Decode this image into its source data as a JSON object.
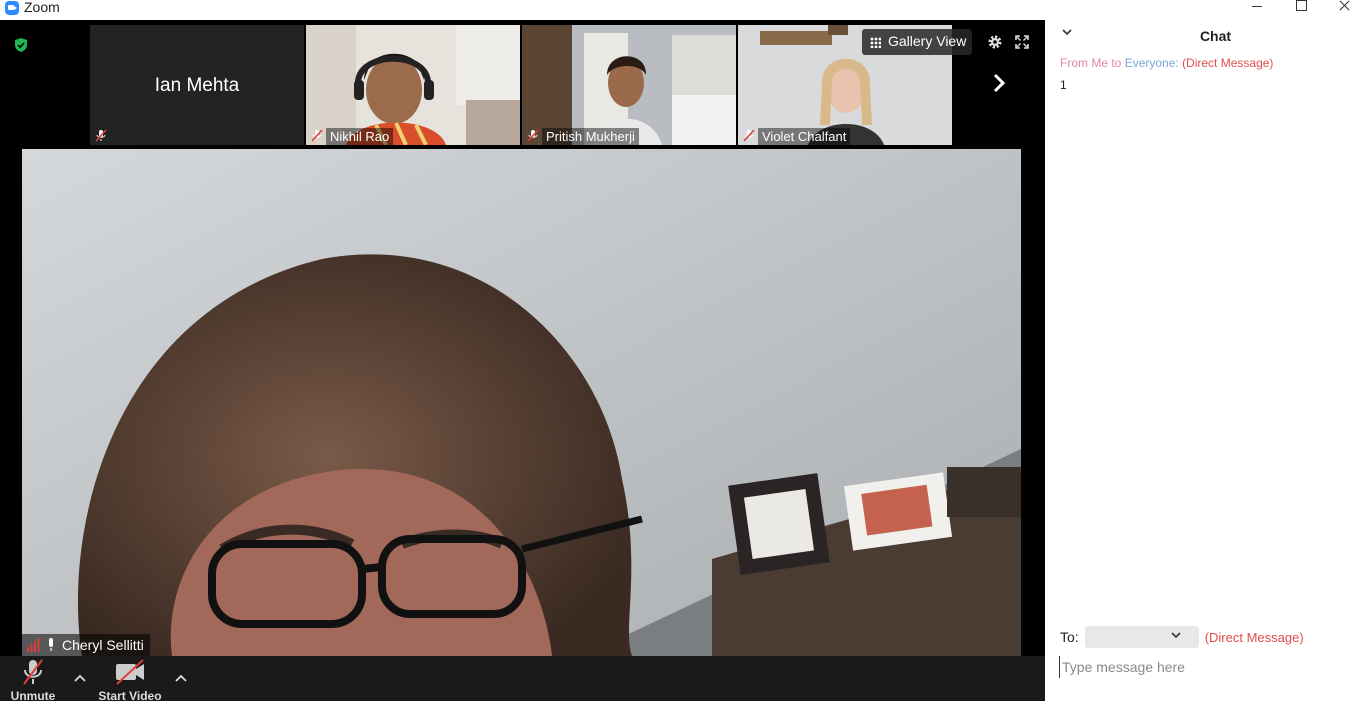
{
  "window": {
    "title": "Zoom"
  },
  "gallery": {
    "view_button_label": "Gallery View",
    "participants": [
      {
        "name": "Ian Mehta"
      },
      {
        "name": "Nikhil Rao"
      },
      {
        "name": "Pritish Mukherji"
      },
      {
        "name": "Violet Chalfant"
      }
    ]
  },
  "active_speaker": {
    "name": "Cheryl Sellitti"
  },
  "toolbar": {
    "unmute_label": "Unmute",
    "start_video_label": "Start Video"
  },
  "chat": {
    "title": "Chat",
    "message": {
      "from": "From Me to",
      "to": "Everyone:",
      "tag": "(Direct Message)",
      "body": "1"
    },
    "to_label": "To:",
    "to_tag": "(Direct Message)",
    "input_placeholder": "Type message here"
  },
  "colors": {
    "brand": "#2D8CFF",
    "encryption_shield": "#1DB954",
    "direct_message": "#E14C4C",
    "muted_slash": "#E03C3C"
  },
  "icons": [
    "zoom-app-icon",
    "shield-icon",
    "mic-muted-icon",
    "grid-icon",
    "gear-icon",
    "fullscreen-icon",
    "chevron-right-icon",
    "signal-icon",
    "mic-icon",
    "video-off-icon",
    "chevron-up-icon",
    "chevron-down-icon"
  ]
}
